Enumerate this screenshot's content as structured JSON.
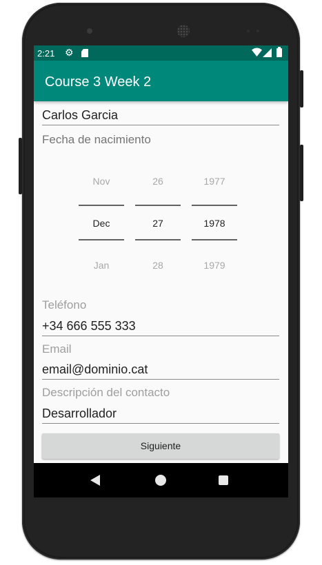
{
  "status_bar": {
    "time": "2:21",
    "icons": [
      "gear-icon",
      "sd-card-icon",
      "wifi-icon",
      "signal-icon",
      "battery-icon"
    ]
  },
  "app_bar": {
    "title": "Course 3 Week 2"
  },
  "form": {
    "name_value": "Carlos Garcia",
    "birth_label": "Fecha de nacimiento",
    "date_picker": {
      "month": {
        "prev": "Nov",
        "selected": "Dec",
        "next": "Jan"
      },
      "day": {
        "prev": "26",
        "selected": "27",
        "next": "28"
      },
      "year": {
        "prev": "1977",
        "selected": "1978",
        "next": "1979"
      }
    },
    "phone_hint": "Teléfono",
    "phone_value": "+34 666 555 333",
    "email_hint": "Email",
    "email_value": "email@dominio.cat",
    "description_hint": "Descripción del contacto",
    "description_value": "Desarrollador",
    "next_button": "Siguiente"
  },
  "nav_bar": {
    "icons": [
      "back-icon",
      "home-icon",
      "recents-icon"
    ]
  },
  "colors": {
    "status_bar": "#00695c",
    "app_bar": "#00897b",
    "background": "#fafafa",
    "button": "#d6d7d7"
  }
}
